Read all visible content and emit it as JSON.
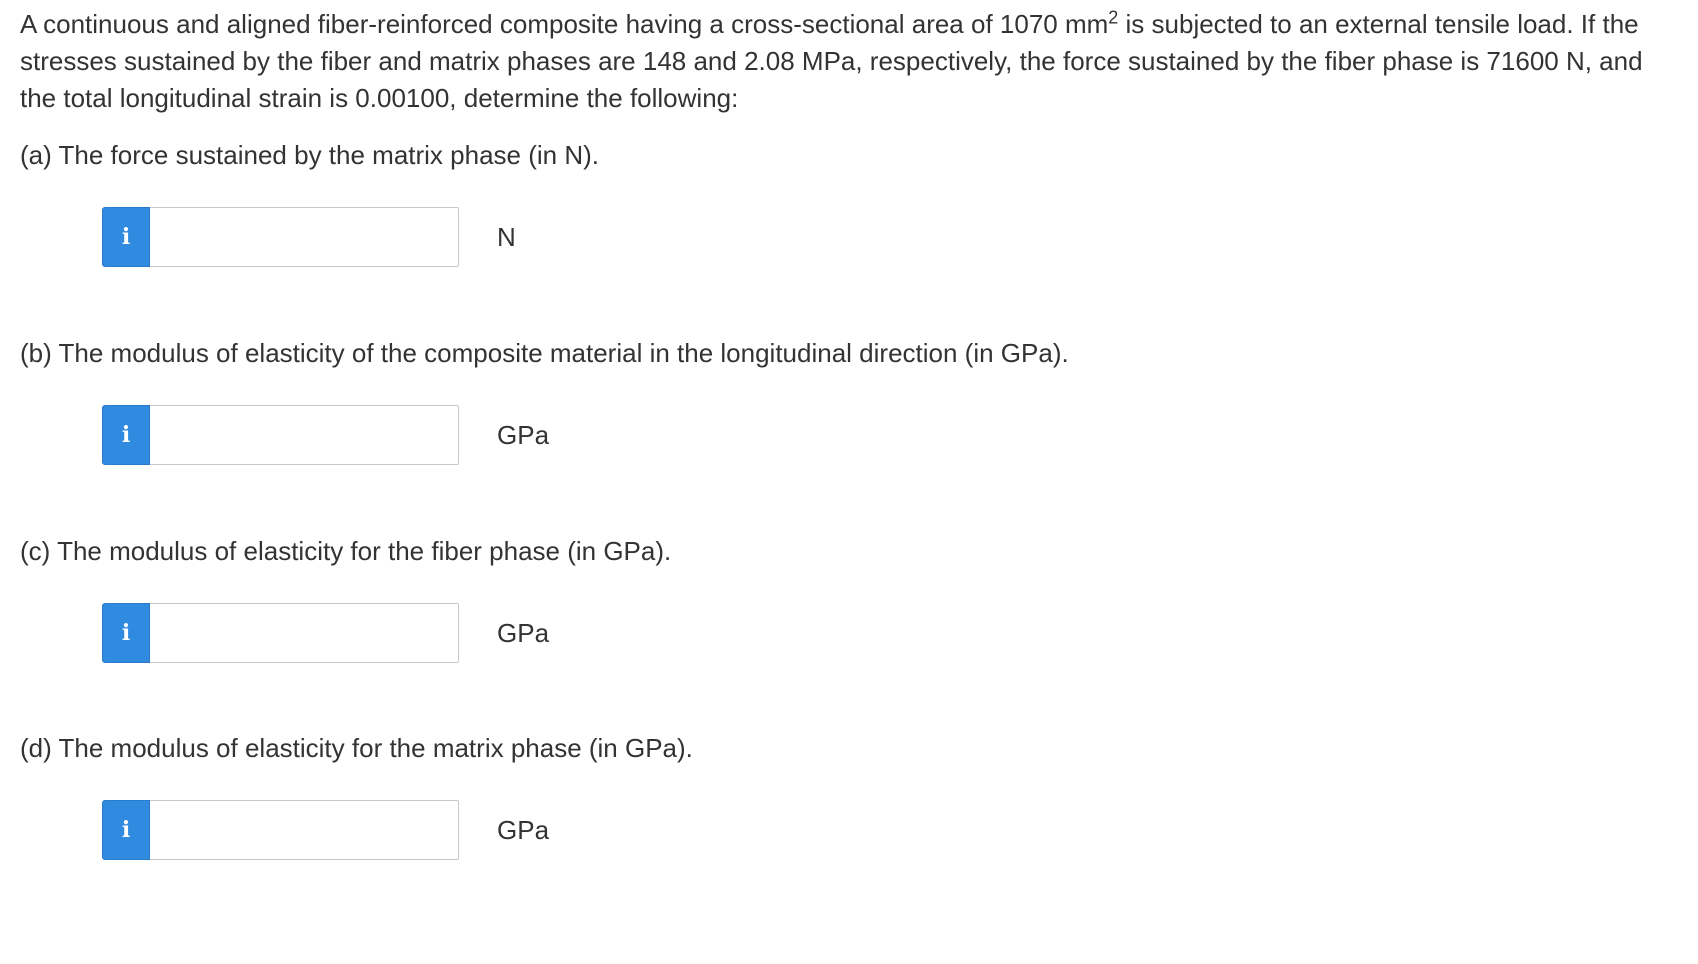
{
  "problem": {
    "text_before_sup": "A continuous and aligned fiber-reinforced composite having a cross-sectional area of 1070 mm",
    "sup": "2",
    "text_after_sup": " is subjected to an external tensile load. If the stresses sustained by the fiber and matrix phases are 148 and 2.08 MPa, respectively, the force sustained by the fiber phase is 71600 N, and the total longitudinal strain is 0.00100, determine the following:"
  },
  "info_icon": "i",
  "questions": [
    {
      "label": "(a) The force sustained by the matrix phase (in N).",
      "value": "",
      "unit": "N"
    },
    {
      "label": "(b) The modulus of elasticity of the composite material in the longitudinal direction (in GPa).",
      "value": "",
      "unit": "GPa"
    },
    {
      "label": "(c) The modulus of elasticity for the fiber phase (in GPa).",
      "value": "",
      "unit": "GPa"
    },
    {
      "label": "(d) The modulus of elasticity for the matrix phase (in GPa).",
      "value": "",
      "unit": "GPa"
    }
  ],
  "colors": {
    "info_button": "#2f8ae0",
    "text": "#333333",
    "input_border": "#c8c8c8"
  },
  "icons": {
    "info": "info-icon"
  }
}
